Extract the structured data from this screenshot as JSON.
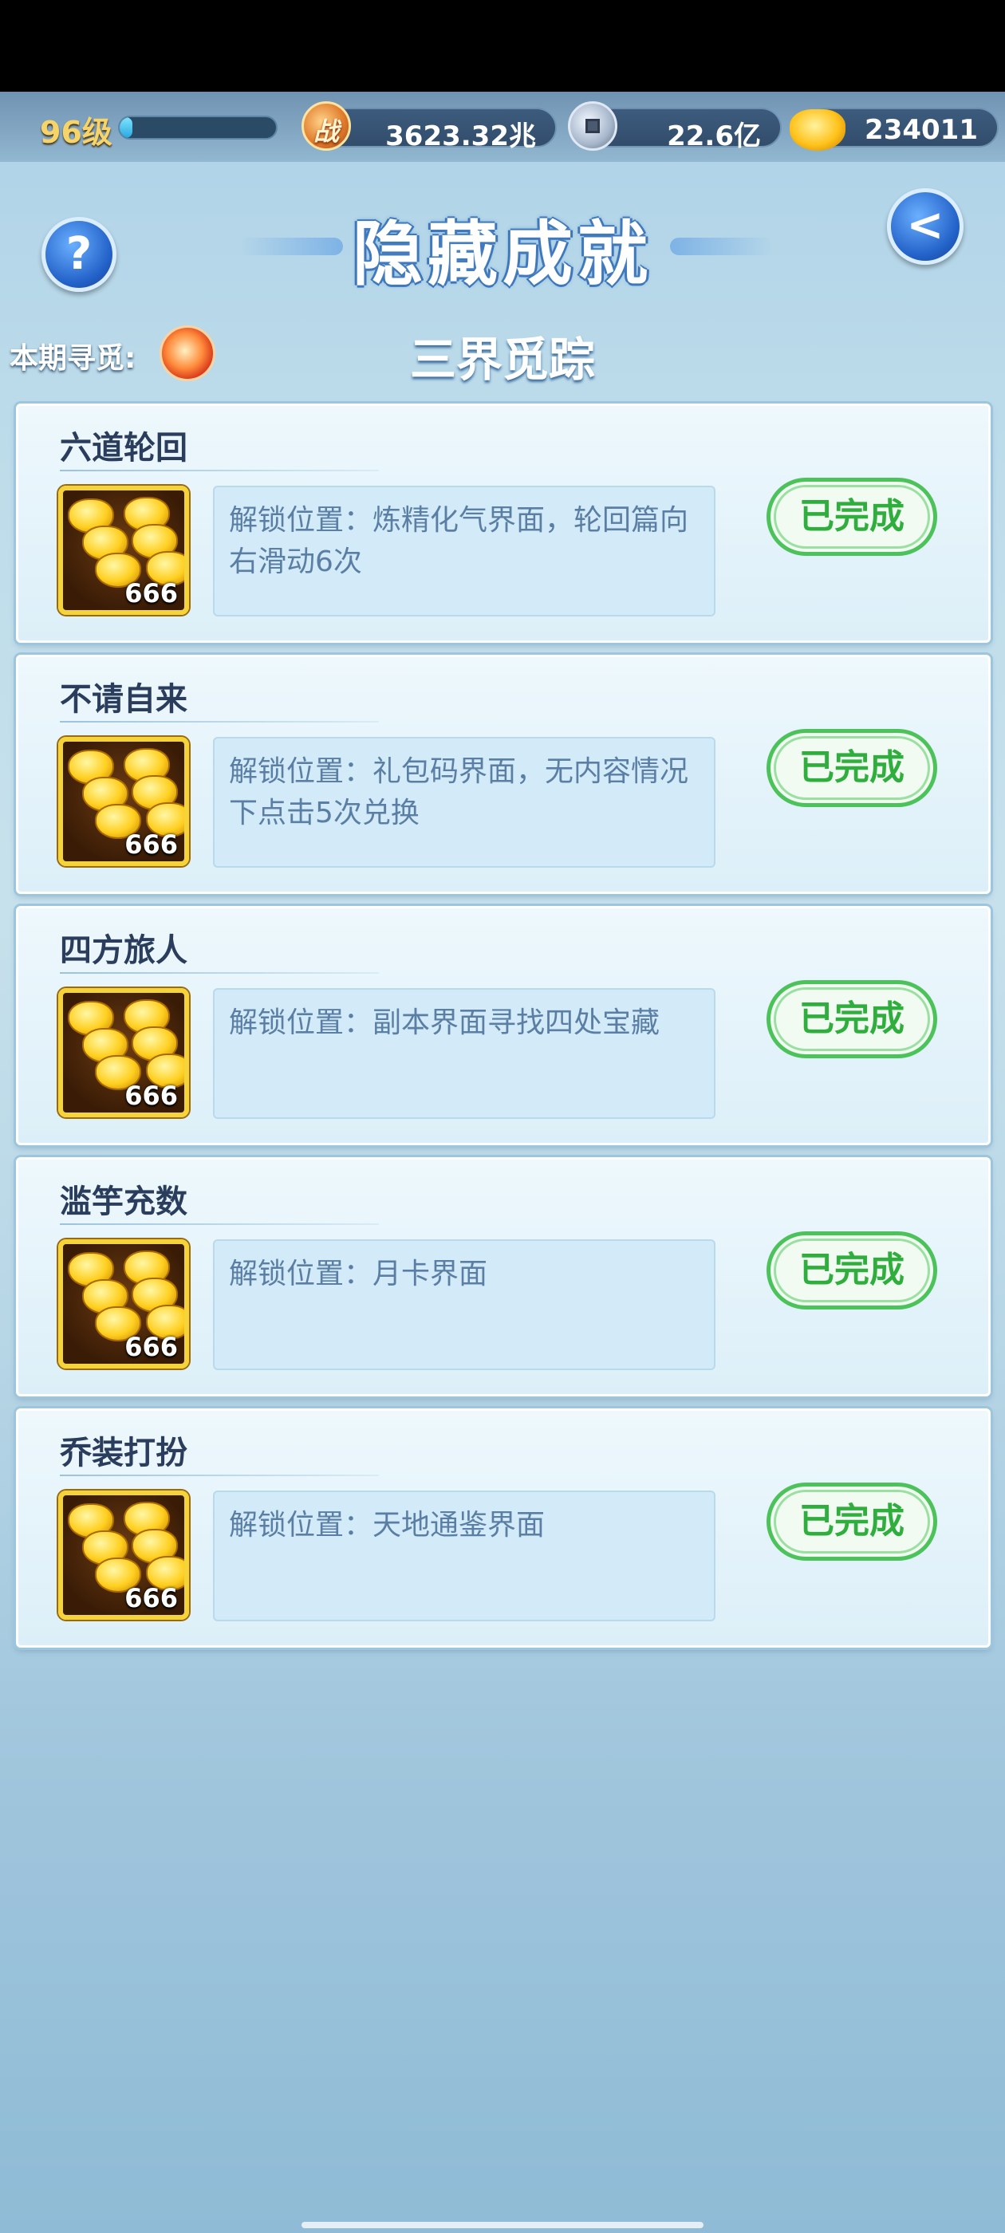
{
  "topbar": {
    "level": "96级",
    "xp_progress": 0.08,
    "power_icon_text": "战",
    "power": "3623.32兆",
    "coins": "22.6亿",
    "gold": "234011"
  },
  "header": {
    "title": "隐藏成就",
    "help_icon": "?",
    "back_icon": "<",
    "period_label": "本期寻觅:",
    "subtitle": "三界觅踪"
  },
  "achievements": [
    {
      "name": "六道轮回",
      "reward_count": "666",
      "description": "解锁位置：炼精化气界面，轮回篇向右滑动6次",
      "status": "已完成"
    },
    {
      "name": "不请自来",
      "reward_count": "666",
      "description": "解锁位置：礼包码界面，无内容情况下点击5次兑换",
      "status": "已完成"
    },
    {
      "name": "四方旅人",
      "reward_count": "666",
      "description": "解锁位置：副本界面寻找四处宝藏",
      "status": "已完成"
    },
    {
      "name": "滥竽充数",
      "reward_count": "666",
      "description": "解锁位置：月卡界面",
      "status": "已完成"
    },
    {
      "name": "乔装打扮",
      "reward_count": "666",
      "description": "解锁位置：天地通鉴界面",
      "status": "已完成"
    }
  ],
  "colors": {
    "done_green": "#2fae3e",
    "title_blue": "#3b72b5",
    "card_text": "#2b3d5c"
  }
}
